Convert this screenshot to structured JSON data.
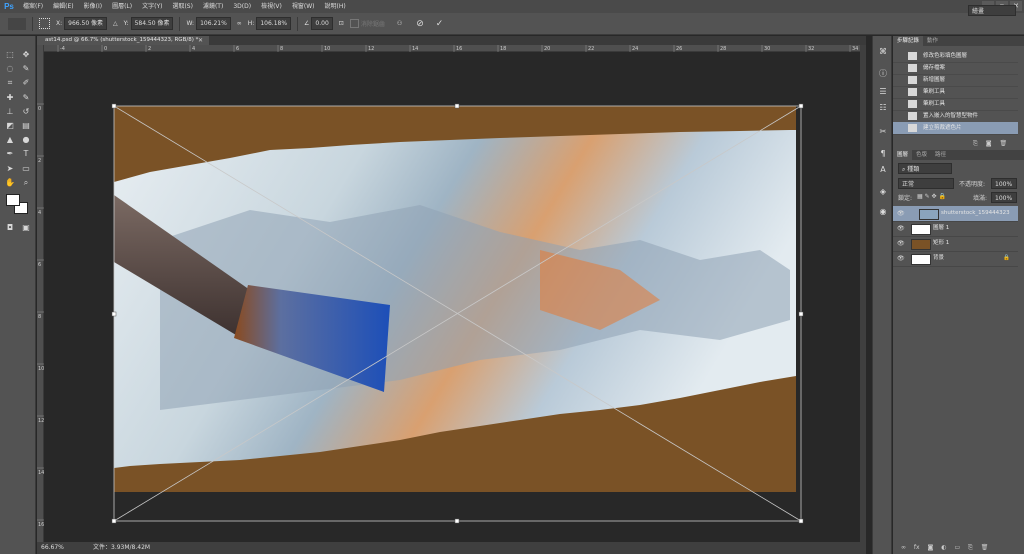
{
  "app": {
    "logo": "Ps"
  },
  "menu": [
    "檔案(F)",
    "編輯(E)",
    "影像(I)",
    "圖層(L)",
    "文字(Y)",
    "選取(S)",
    "濾鏡(T)",
    "3D(D)",
    "檢視(V)",
    "視窗(W)",
    "說明(H)"
  ],
  "window_buttons": {
    "minimize": "–",
    "restore": "▫",
    "close": "✕"
  },
  "options": {
    "x_label": "X:",
    "x_value": "966.50 像素",
    "y_label": "Y:",
    "y_value": "584.50 像素",
    "w_label": "W:",
    "w_value": "106.21%",
    "h_label": "H:",
    "h_value": "106.18%",
    "angle_value": "0.00",
    "interp_label": "消除鋸齒",
    "cancel_icon": "cancel-icon",
    "commit_icon": "commit-icon",
    "workspace": "繪畫"
  },
  "document": {
    "tab_title": "ast14.psd @ 66.7% (shutterstock_159444323, RGB/8) *",
    "close": "✕",
    "zoom": "66.67%",
    "doc_size": "文件：3.93M/8.42M",
    "ruler_h": [
      "-4",
      "0",
      "2",
      "4",
      "6",
      "8",
      "10",
      "12",
      "14",
      "16",
      "18",
      "20",
      "22",
      "24",
      "26",
      "28",
      "30",
      "32",
      "34"
    ],
    "ruler_v": [
      "0",
      "2",
      "4",
      "6",
      "8",
      "10",
      "12",
      "14",
      "16"
    ]
  },
  "colors": {
    "brown": "#7a5226",
    "panel": "#535353",
    "selected": "#8a9cb4",
    "fg": "#ffffff",
    "bg": "#ffffff"
  },
  "history": {
    "tabs": [
      "步驟記錄",
      "動作"
    ],
    "items": [
      "修改色彩填色圖層",
      "儲存檔案",
      "新增圖層",
      "筆刷工具",
      "筆刷工具",
      "置入嵌入的智慧型物件",
      "建立剪裁遮色片"
    ]
  },
  "layers": {
    "tabs": [
      "圖層",
      "色版",
      "路徑"
    ],
    "filter_kind": "種類",
    "blend_mode": "正常",
    "opacity_label": "不透明度:",
    "opacity_value": "100%",
    "lock_label": "鎖定:",
    "fill_label": "填滿:",
    "fill_value": "100%",
    "items": [
      {
        "name": "shutterstock_159444323",
        "selected": true
      },
      {
        "name": "圖層 1",
        "selected": false
      },
      {
        "name": "矩形 1",
        "selected": false
      },
      {
        "name": "背景",
        "selected": false,
        "locked": true
      }
    ]
  }
}
